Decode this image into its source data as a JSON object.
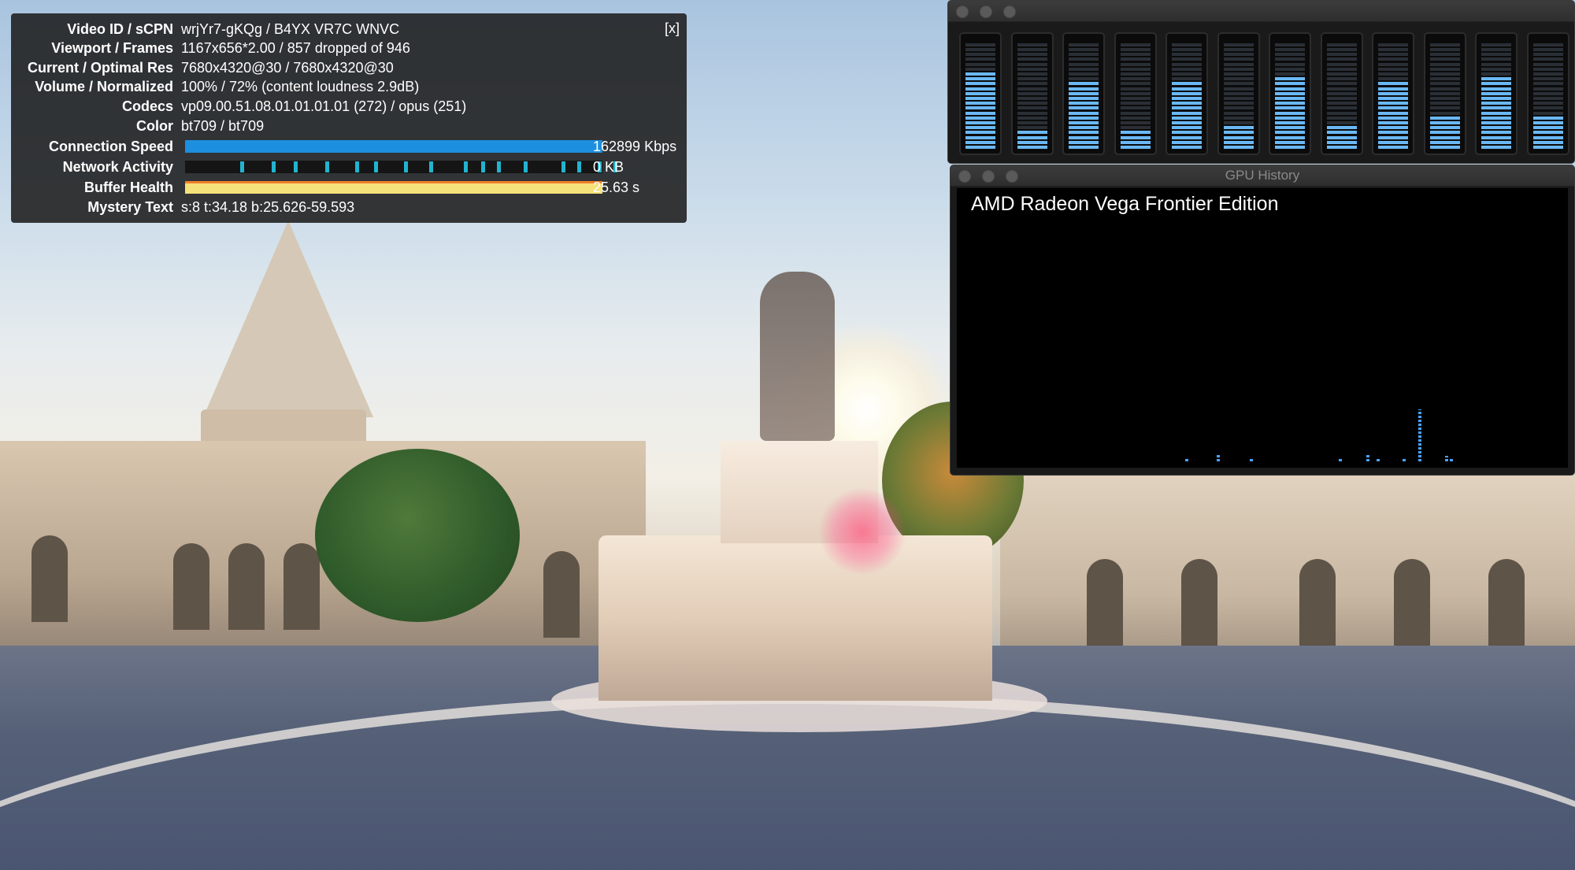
{
  "stats_for_nerds": {
    "close_label": "[x]",
    "rows": [
      {
        "label": "Video ID / sCPN",
        "value": "wrjYr7-gKQg / B4YX VR7C WNVC"
      },
      {
        "label": "Viewport / Frames",
        "value": "1167x656*2.00 / 857 dropped of 946"
      },
      {
        "label": "Current / Optimal Res",
        "value": "7680x4320@30 / 7680x4320@30"
      },
      {
        "label": "Volume / Normalized",
        "value": "100% / 72% (content loudness 2.9dB)"
      },
      {
        "label": "Codecs",
        "value": "vp09.00.51.08.01.01.01.01 (272) / opus (251)"
      },
      {
        "label": "Color",
        "value": "bt709 / bt709"
      },
      {
        "label": "Connection Speed",
        "value": "162899 Kbps"
      },
      {
        "label": "Network Activity",
        "value": "0 KB"
      },
      {
        "label": "Buffer Health",
        "value": "25.63 s"
      },
      {
        "label": "Mystery Text",
        "value": "s:8 t:34.18 b:25.626-59.593"
      }
    ],
    "connection_speed_fill": 1.0,
    "buffer_health_fill": 1.0,
    "colors": {
      "connection": "#1d8fe0",
      "network": "#22b3cf",
      "buffer": "#f5e27a",
      "buffer_edge": "#f2802b"
    }
  },
  "cpu_meter_window": {
    "meter_levels": [
      0.72,
      0.2,
      0.65,
      0.18,
      0.62,
      0.24,
      0.68,
      0.24,
      0.62,
      0.3,
      0.68,
      0.3
    ],
    "segment_color": "#6ab8f5"
  },
  "gpu_history_window": {
    "title": "GPU History",
    "gpu_name": "AMD Radeon Vega Frontier Edition",
    "spike_color": "#4aa3ff"
  }
}
